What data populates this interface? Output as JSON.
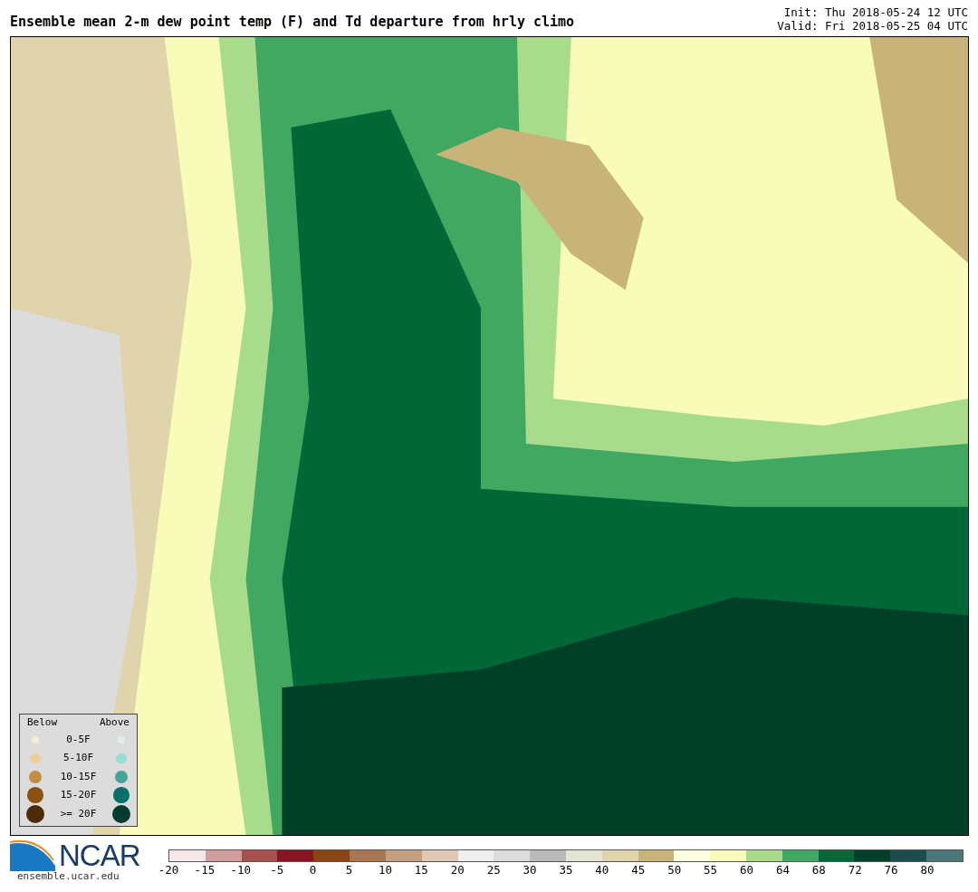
{
  "title": "Ensemble mean 2-m dew point temp (F) and Td departure from hrly climo",
  "init": "Init: Thu 2018-05-24 12 UTC",
  "valid": "Valid: Fri 2018-05-25 04 UTC",
  "legend": {
    "below_label": "Below",
    "above_label": "Above",
    "rows": [
      {
        "label": "0-5F",
        "below_dot": {
          "color": "#f5ecd6"
        },
        "above_dot": {
          "color": "#dcf0f0"
        }
      },
      {
        "label": "5-10F",
        "below_dot": {
          "color": "#ecd098"
        },
        "above_dot": {
          "color": "#98dcd4"
        }
      },
      {
        "label": "10-15F",
        "below_dot": {
          "color": "#c48c40"
        },
        "above_dot": {
          "color": "#44a498"
        }
      },
      {
        "label": "15-20F",
        "below_dot": {
          "color": "#8c5010"
        },
        "above_dot": {
          "color": "#08706a"
        }
      },
      {
        "label": ">= 20F",
        "below_dot": {
          "color": "#4c2c08"
        },
        "above_dot": {
          "color": "#043c30"
        }
      }
    ]
  },
  "logo": {
    "text": "NCAR",
    "url": "ensemble.ucar.edu"
  },
  "colorbar": {
    "bins": [
      {
        "label": "-20",
        "color": "#f5e8e8"
      },
      {
        "label": "-15",
        "color": "#d09c9c"
      },
      {
        "label": "-10",
        "color": "#a85050"
      },
      {
        "label": "-5",
        "color": "#8b1420"
      },
      {
        "label": "0",
        "color": "#8b4513"
      },
      {
        "label": "5",
        "color": "#a87650"
      },
      {
        "label": "10",
        "color": "#c49e80"
      },
      {
        "label": "15",
        "color": "#e0c8b4"
      },
      {
        "label": "20",
        "color": "#f0f0f0"
      },
      {
        "label": "25",
        "color": "#dcdcdc"
      },
      {
        "label": "30",
        "color": "#bababa"
      },
      {
        "label": "35",
        "color": "#e4e4d4"
      },
      {
        "label": "40",
        "color": "#e0d4ac"
      },
      {
        "label": "45",
        "color": "#c8b478"
      },
      {
        "label": "50",
        "color": "#ffffe0"
      },
      {
        "label": "55",
        "color": "#f8fcb8"
      },
      {
        "label": "60",
        "color": "#a8dc8c"
      },
      {
        "label": "64",
        "color": "#40a860"
      },
      {
        "label": "68",
        "color": "#006837"
      },
      {
        "label": "72",
        "color": "#004028"
      },
      {
        "label": "76",
        "color": "#1a4c50"
      },
      {
        "label": "80",
        "color": "#4a7878"
      }
    ]
  }
}
